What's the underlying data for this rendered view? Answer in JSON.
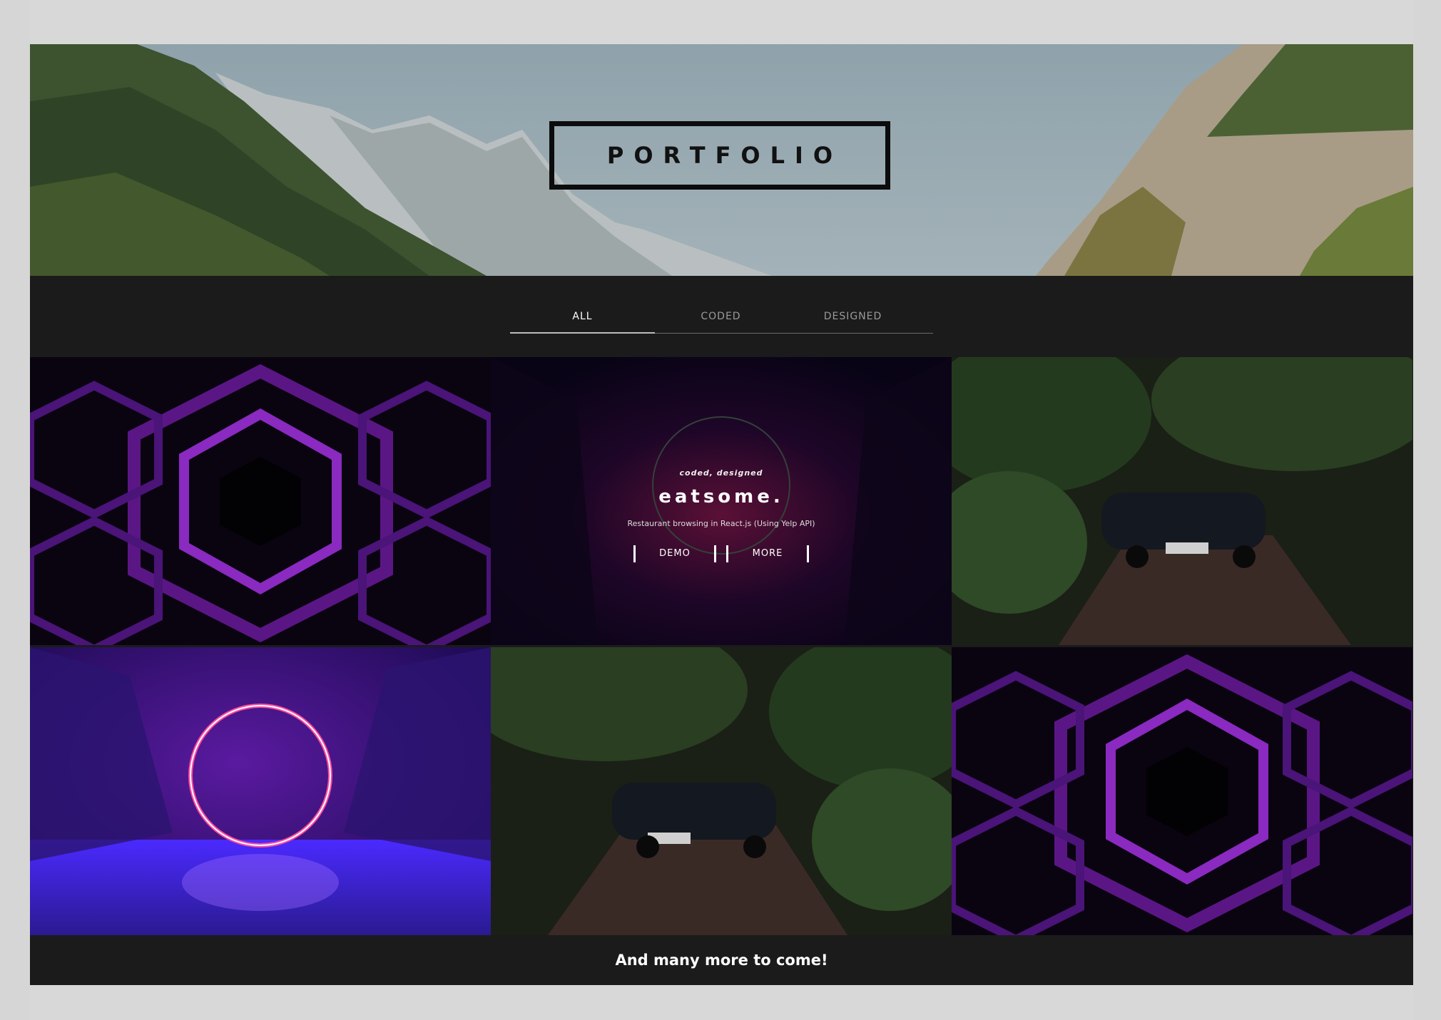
{
  "hero": {
    "title": "PORTFOLIO"
  },
  "tabs": [
    {
      "label": "ALL",
      "active": true
    },
    {
      "label": "CODED",
      "active": false
    },
    {
      "label": "DESIGNED",
      "active": false
    }
  ],
  "projects": [
    {
      "image": "purple-hexagon-tunnel"
    },
    {
      "image": "neon-corridor-ring",
      "tags": "coded, designed",
      "title": "eatsome.",
      "description": "Restaurant browsing in React.js (Using Yelp API)",
      "demo_label": "DEMO",
      "more_label": "MORE"
    },
    {
      "image": "car-in-garden-driveway"
    },
    {
      "image": "neon-ring-crystals"
    },
    {
      "image": "car-in-garden-driveway"
    },
    {
      "image": "purple-hexagon-tunnel"
    }
  ],
  "footer_note": "And many more to come!"
}
